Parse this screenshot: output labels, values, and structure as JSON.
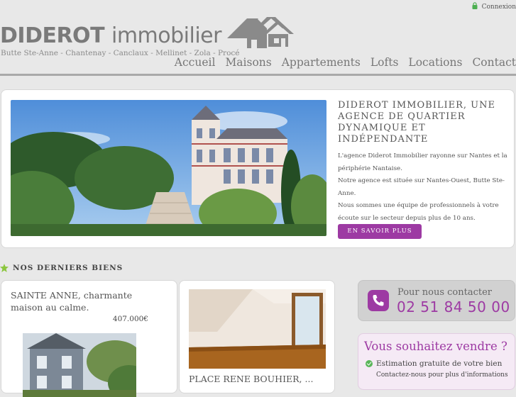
{
  "header": {
    "login_label": "Connexion",
    "brand_bold": "DIDEROT",
    "brand_light": "immobilier",
    "tagline": "Butte Ste-Anne - Chantenay - Canclaux - Mellinet - Zola - Procé"
  },
  "nav": {
    "items": [
      {
        "label": "Accueil"
      },
      {
        "label": "Maisons"
      },
      {
        "label": "Appartements"
      },
      {
        "label": "Lofts"
      },
      {
        "label": "Locations"
      },
      {
        "label": "Contact"
      }
    ]
  },
  "hero": {
    "title": "DIDEROT IMMOBILIER, UNE AGENCE DE QUARTIER DYNAMIQUE ET INDÉPENDANTE",
    "paragraph1": "L'agence Diderot Immobilier rayonne sur Nantes et la périphérie Nantaise.",
    "paragraph2": "Notre agence est située sur Nantes-Ouest, Butte Ste-Anne.",
    "paragraph3": "Nous sommes une équipe de professionnels à votre écoute sur le secteur depuis plus de 10 ans.",
    "button_label": "EN SAVOIR PLUS"
  },
  "section": {
    "title": "NOS DERNIERS BIENS"
  },
  "listings": [
    {
      "title": "SAINTE ANNE, charmante maison au calme.",
      "price": "407.000€"
    },
    {
      "title": "PLACE RENE BOUHIER, ..."
    }
  ],
  "contact": {
    "label": "Pour nous contacter",
    "number": "02 51 84 50 00"
  },
  "sell": {
    "title": "Vous souhaitez vendre ?",
    "line1": "Estimation gratuite de votre bien",
    "line2": "Contactez-nous pour plus d'informations"
  },
  "colors": {
    "accent": "#9d3aa3",
    "brand_grey": "#7a7a7a",
    "background": "#e8e8e8",
    "check_green": "#5ab65a"
  },
  "icons": {
    "login": "lock-icon",
    "logo": "houses-logo",
    "section_bullet": "star-icon",
    "contact": "phone-icon",
    "sell_bullet": "check-icon"
  }
}
